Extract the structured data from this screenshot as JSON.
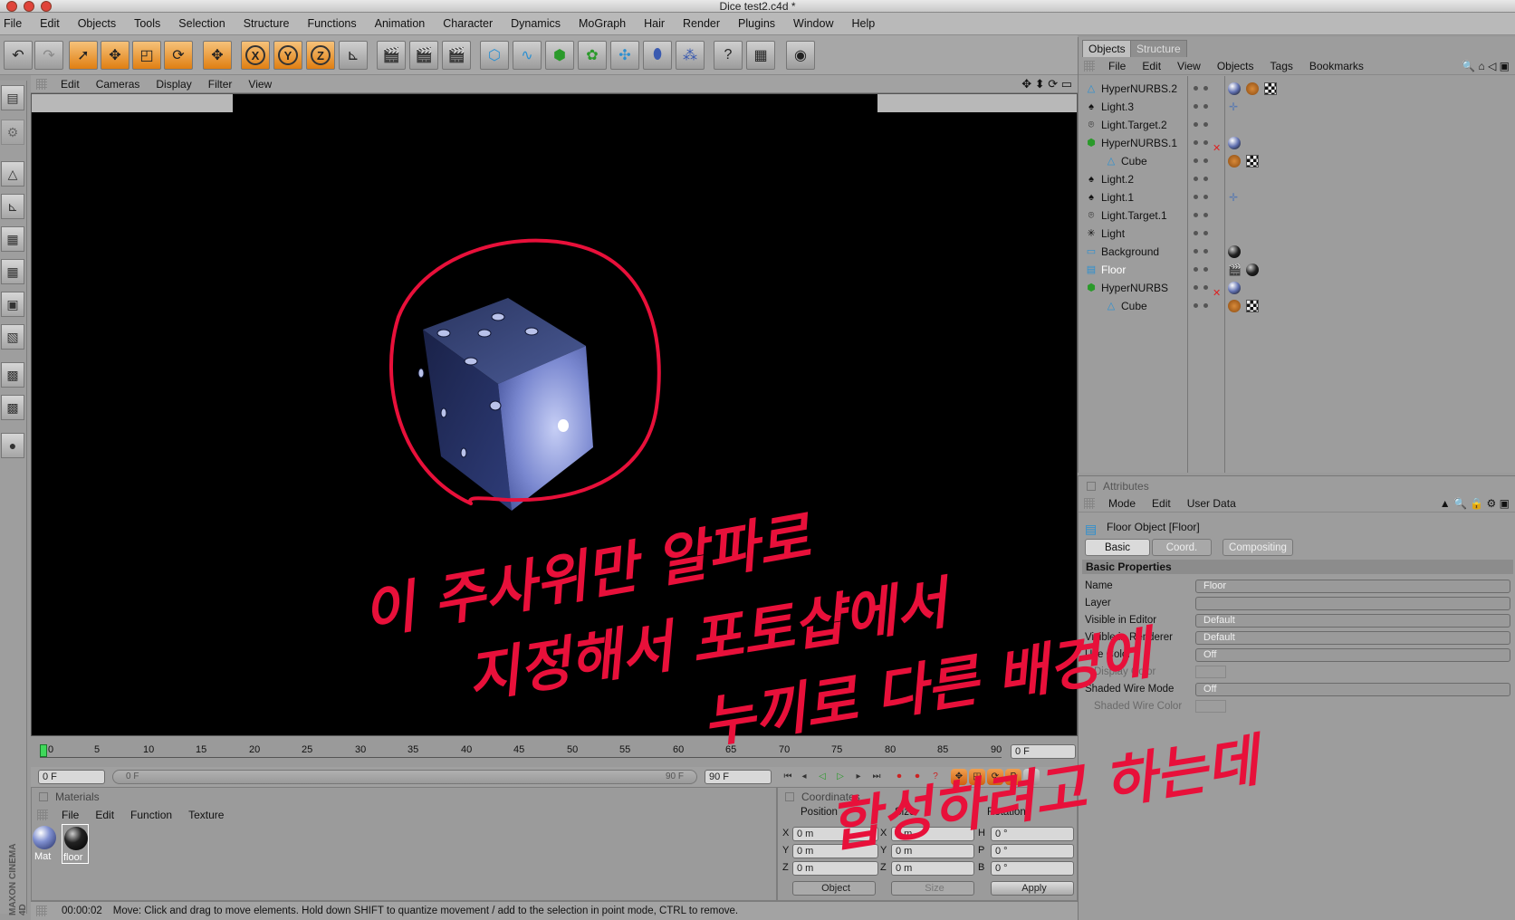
{
  "window": {
    "title": "Dice test2.c4d *"
  },
  "menu": [
    "File",
    "Edit",
    "Objects",
    "Tools",
    "Selection",
    "Structure",
    "Functions",
    "Animation",
    "Character",
    "Dynamics",
    "MoGraph",
    "Hair",
    "Render",
    "Plugins",
    "Window",
    "Help"
  ],
  "toolbar": {
    "axis_x": "X",
    "axis_y": "Y",
    "axis_z": "Z"
  },
  "viewport": {
    "menu": [
      "Edit",
      "Cameras",
      "Display",
      "Filter",
      "View"
    ]
  },
  "timeline": {
    "ticks": [
      "0",
      "5",
      "10",
      "15",
      "20",
      "25",
      "30",
      "35",
      "40",
      "45",
      "50",
      "55",
      "60",
      "65",
      "70",
      "75",
      "80",
      "85",
      "90"
    ],
    "current_frame": "0 F",
    "start_field": "0 F",
    "range_start": "0 F",
    "range_end": "90 F",
    "end_field": "90 F"
  },
  "materials": {
    "title": "Materials",
    "menu": [
      "File",
      "Edit",
      "Function",
      "Texture"
    ],
    "items": [
      {
        "name": "Mat"
      },
      {
        "name": "floor"
      }
    ]
  },
  "coordinates": {
    "title": "Coordinates",
    "headers": [
      "Position",
      "Size",
      "Rotation"
    ],
    "rows": [
      {
        "p": "X",
        "pv": "0 m",
        "s": "X",
        "sv": "0 m",
        "r": "H",
        "rv": "0 °"
      },
      {
        "p": "Y",
        "pv": "0 m",
        "s": "Y",
        "sv": "0 m",
        "r": "P",
        "rv": "0 °"
      },
      {
        "p": "Z",
        "pv": "0 m",
        "s": "Z",
        "sv": "0 m",
        "r": "B",
        "rv": "0 °"
      }
    ],
    "mode": "Object",
    "size_mode": "Size",
    "apply": "Apply"
  },
  "status": {
    "time": "00:00:02",
    "message": "Move: Click and drag to move elements. Hold down SHIFT to quantize movement / add to the selection in point mode, CTRL to remove."
  },
  "objects_panel": {
    "tabs": [
      "Objects",
      "Structure"
    ],
    "menu": [
      "File",
      "Edit",
      "View",
      "Objects",
      "Tags",
      "Bookmarks"
    ],
    "items": [
      {
        "name": "HyperNURBS.2"
      },
      {
        "name": "Light.3"
      },
      {
        "name": "Light.Target.2"
      },
      {
        "name": "HyperNURBS.1"
      },
      {
        "name": "Cube"
      },
      {
        "name": "Light.2"
      },
      {
        "name": "Light.1"
      },
      {
        "name": "Light.Target.1"
      },
      {
        "name": "Light"
      },
      {
        "name": "Background"
      },
      {
        "name": "Floor"
      },
      {
        "name": "HyperNURBS"
      },
      {
        "name": "Cube"
      }
    ]
  },
  "attributes_panel": {
    "title": "Attributes",
    "menu": [
      "Mode",
      "Edit",
      "User Data"
    ],
    "object_title": "Floor Object [Floor]",
    "tabs": [
      "Basic",
      "Coord.",
      "Compositing"
    ],
    "section": "Basic Properties",
    "fields": [
      {
        "label": "Name",
        "value": "Floor"
      },
      {
        "label": "Layer",
        "value": ""
      },
      {
        "label": "Visible in Editor",
        "value": "Default"
      },
      {
        "label": "Visible in Renderer",
        "value": "Default"
      },
      {
        "label": "Use Color",
        "value": "Off"
      },
      {
        "label": "Display Color",
        "value": ""
      },
      {
        "label": "Shaded Wire Mode",
        "value": "Off"
      },
      {
        "label": "Shaded Wire Color",
        "value": ""
      }
    ]
  },
  "branding": "MAXON CINEMA 4D",
  "annotation_lines": [
    "이 주사위만 알파로",
    "지정해서 포토샵에서",
    "누끼로 다른 배경에",
    "합성하려고 하는데"
  ]
}
